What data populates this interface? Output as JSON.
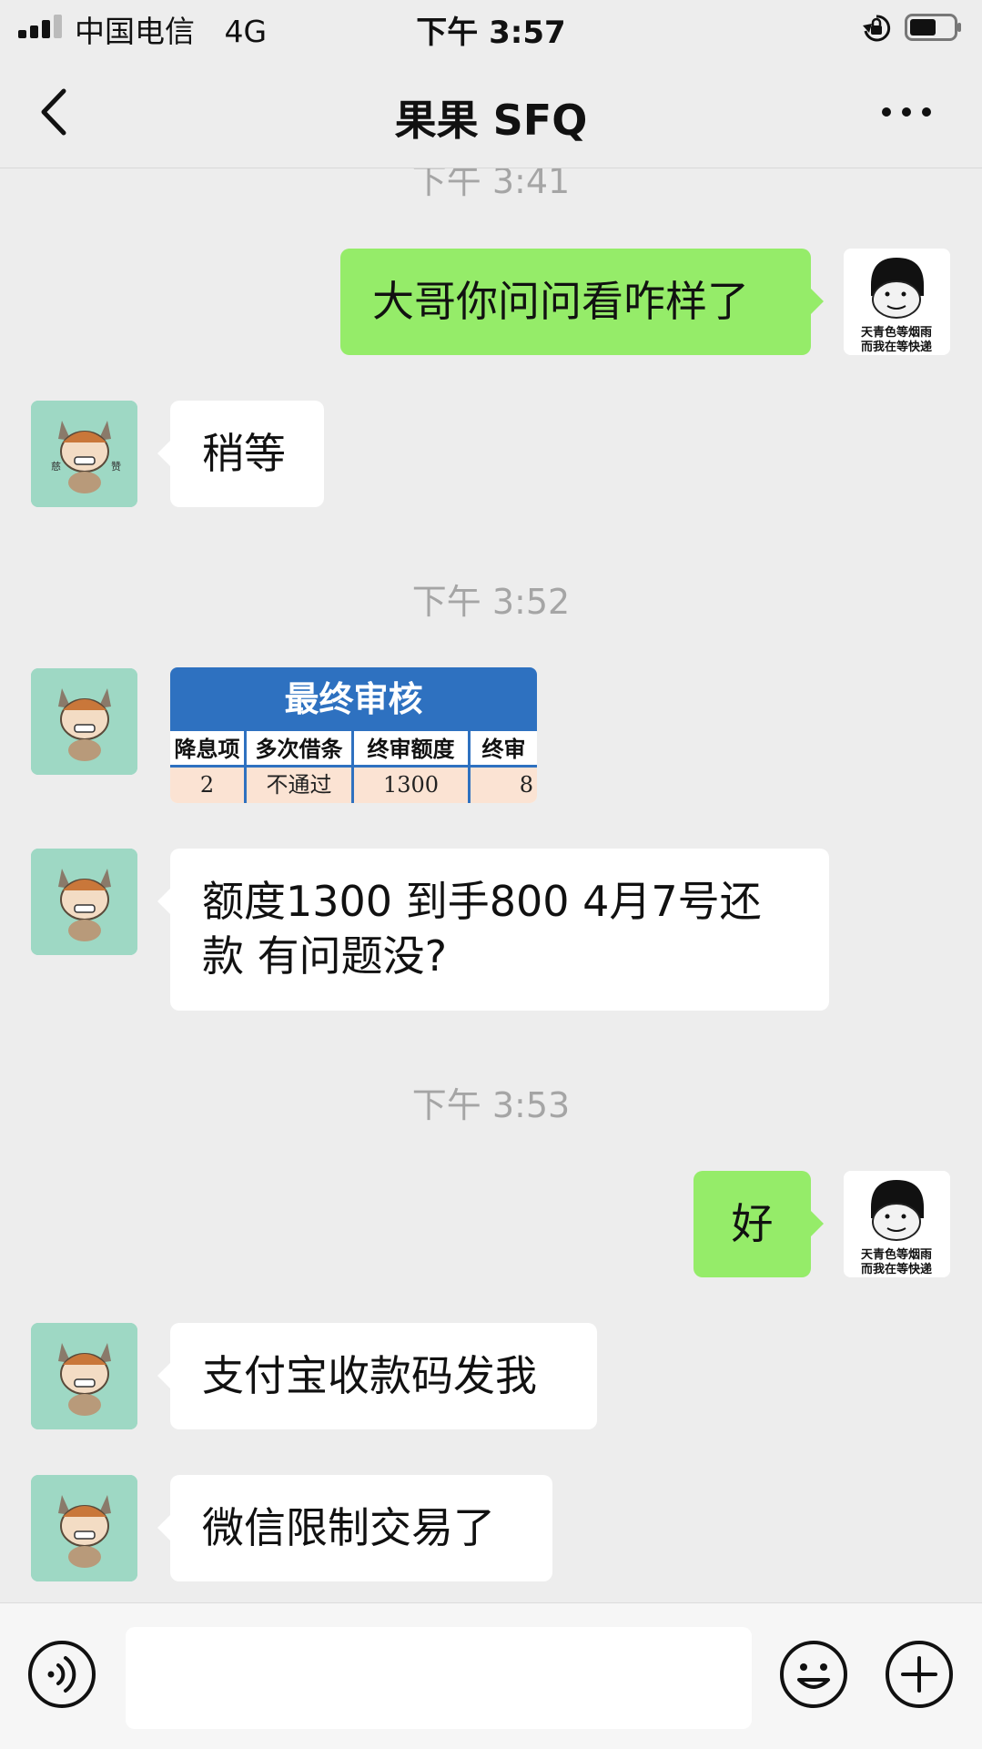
{
  "status_bar": {
    "carrier": "中国电信",
    "network": "4G",
    "time": "下午 3:57"
  },
  "nav": {
    "title": "果果 SFQ"
  },
  "messages": [
    {
      "type": "timestamp",
      "text": "下午 3:41"
    },
    {
      "type": "text",
      "sender": "me",
      "text": "大哥你问问看咋样了"
    },
    {
      "type": "text",
      "sender": "them",
      "text": "稍等"
    },
    {
      "type": "timestamp",
      "text": "下午 3:52"
    },
    {
      "type": "image",
      "sender": "them"
    },
    {
      "type": "text",
      "sender": "them",
      "lines": [
        "额度1300 到手800 4月7号还",
        "款 有问题没?"
      ]
    },
    {
      "type": "timestamp",
      "text": "下午 3:53"
    },
    {
      "type": "text",
      "sender": "me",
      "text": "好"
    },
    {
      "type": "text",
      "sender": "them",
      "text": "支付宝收款码发我"
    },
    {
      "type": "text",
      "sender": "them",
      "text": "微信限制交易了"
    }
  ],
  "image_message": {
    "title": "最终审核",
    "headers": [
      "降息项",
      "多次借条",
      "终审额度",
      "终审"
    ],
    "values": [
      "2",
      "不通过",
      "1300",
      "8"
    ]
  },
  "avatars": {
    "me_caption_line1": "天青色等烟雨",
    "me_caption_line2": "而我在等快递",
    "them_caption_left": "慈",
    "them_caption_right": "赞"
  },
  "colors": {
    "background": "#ededed",
    "bubble_me": "#95ec69",
    "bubble_them": "#ffffff",
    "timestamp": "#a5a5a5",
    "table_header": "#2e71c0"
  },
  "input_bar": {
    "text_value": "",
    "icons": [
      "voice-icon",
      "emoji-icon",
      "plus-icon"
    ]
  }
}
